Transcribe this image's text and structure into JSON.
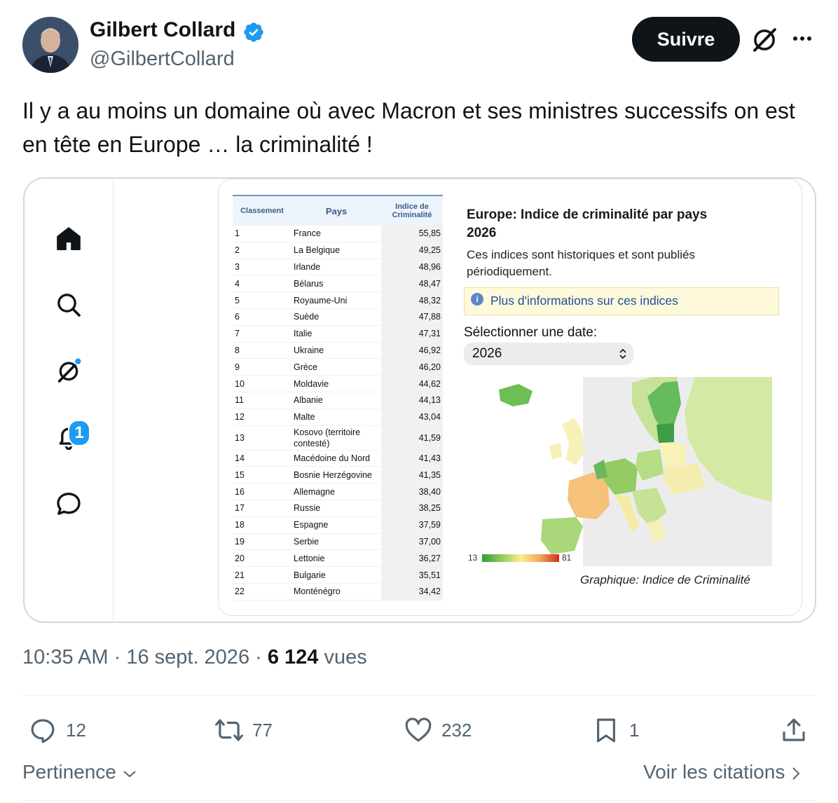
{
  "author": {
    "name": "Gilbert Collard",
    "handle": "@GilbertCollard",
    "follow_label": "Suivre"
  },
  "tweet": {
    "text": "Il y a au moins un domaine où avec Macron et ses ministres successifs on est en tête en Europe … la criminalité !"
  },
  "card_sidebar": {
    "icons": [
      "home-icon",
      "search-icon",
      "grok-icon",
      "notifications-icon",
      "messages-icon"
    ],
    "notification_count": "1"
  },
  "image": {
    "table": {
      "headers": [
        "Classement",
        "Pays",
        "Indice de Criminalité"
      ],
      "rows": [
        [
          "1",
          "France",
          "55,85"
        ],
        [
          "2",
          "La Belgique",
          "49,25"
        ],
        [
          "3",
          "Irlande",
          "48,96"
        ],
        [
          "4",
          "Bélarus",
          "48,47"
        ],
        [
          "5",
          "Royaume-Uni",
          "48,32"
        ],
        [
          "6",
          "Suède",
          "47,88"
        ],
        [
          "7",
          "Italie",
          "47,31"
        ],
        [
          "8",
          "Ukraine",
          "46,92"
        ],
        [
          "9",
          "Grèce",
          "46,20"
        ],
        [
          "10",
          "Moldavie",
          "44,62"
        ],
        [
          "11",
          "Albanie",
          "44,13"
        ],
        [
          "12",
          "Malte",
          "43,04"
        ],
        [
          "13",
          "Kosovo (territoire contesté)",
          "41,59"
        ],
        [
          "14",
          "Macédoine du Nord",
          "41,43"
        ],
        [
          "15",
          "Bosnie Herzégovine",
          "41,35"
        ],
        [
          "16",
          "Allemagne",
          "38,40"
        ],
        [
          "17",
          "Russie",
          "38,25"
        ],
        [
          "18",
          "Espagne",
          "37,59"
        ],
        [
          "19",
          "Serbie",
          "37,00"
        ],
        [
          "20",
          "Lettonie",
          "36,27"
        ],
        [
          "21",
          "Bulgarie",
          "35,51"
        ],
        [
          "22",
          "Monténégro",
          "34,42"
        ]
      ]
    },
    "panel": {
      "title_line1": "Europe: Indice de criminalité par pays",
      "title_line2": "2026",
      "description": "Ces indices sont historiques et sont publiés périodiquement.",
      "info_link": "Plus d'informations sur ces indices",
      "date_label": "Sélectionner une date:",
      "date_value": "2026",
      "legend_min": "13",
      "legend_max": "81",
      "caption": "Graphique: Indice de Criminalité"
    }
  },
  "meta": {
    "time": "10:35 AM",
    "date": "16 sept. 2026",
    "views_count": "6 124",
    "views_label": "vues"
  },
  "actions": {
    "replies": "12",
    "reposts": "77",
    "likes": "232",
    "bookmarks": "1"
  },
  "footer": {
    "sort_label": "Pertinence",
    "quotes_label": "Voir les citations"
  },
  "colors": {
    "accent": "#1d9bf0",
    "text_secondary": "#536471",
    "follow_bg": "#0f1419"
  }
}
